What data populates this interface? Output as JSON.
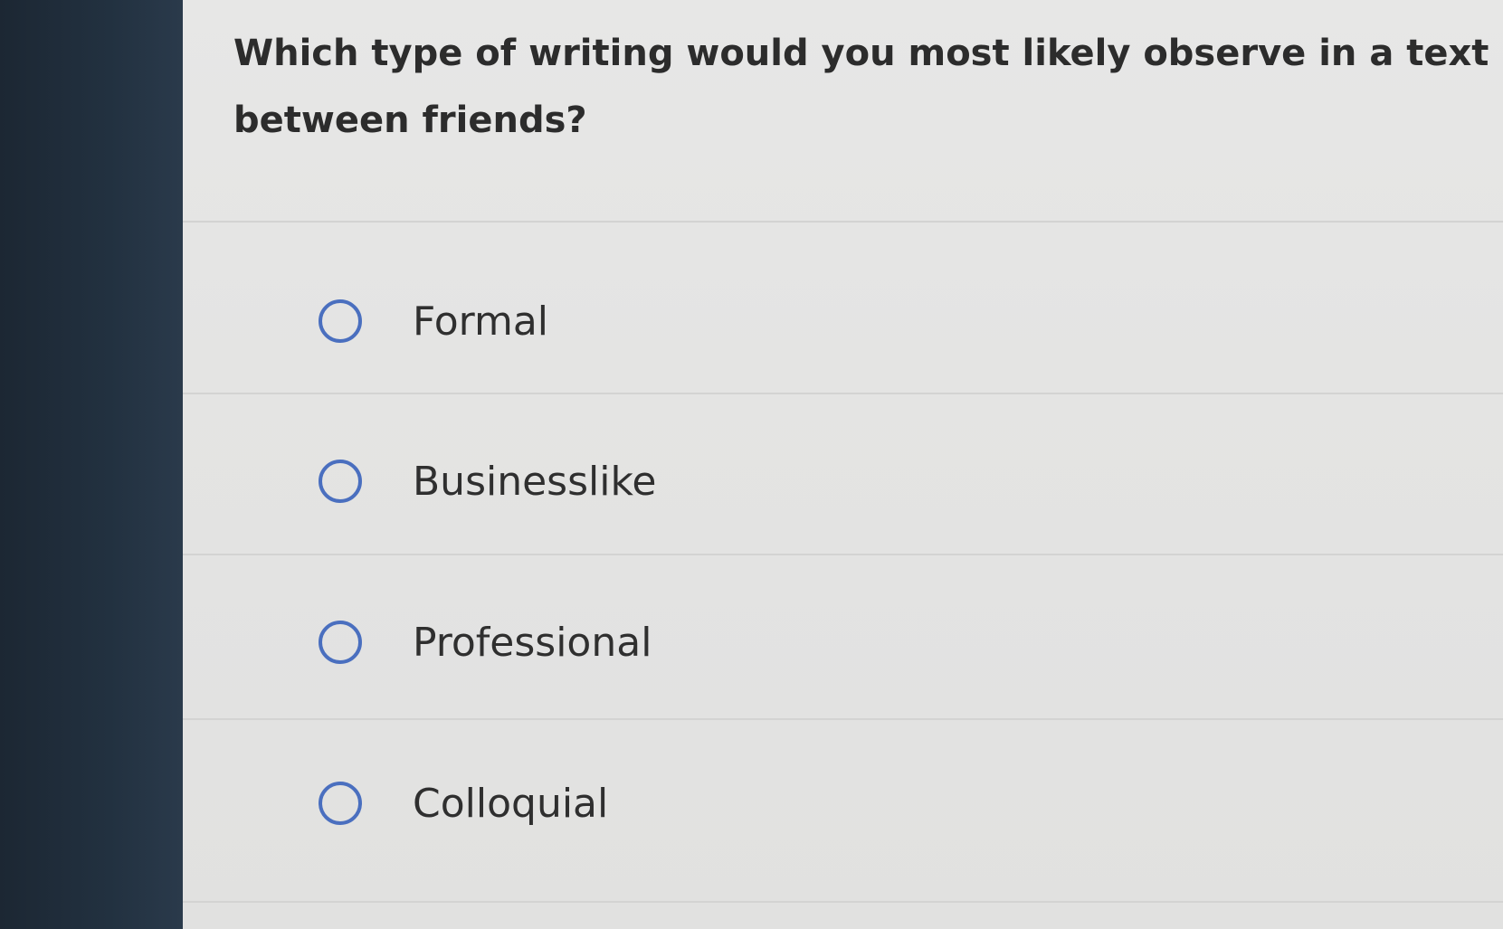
{
  "question": {
    "text_line1": "Which type of writing would you most likely observe in a text m",
    "text_line2": "between friends?"
  },
  "options": [
    {
      "label": "Formal",
      "selected": false
    },
    {
      "label": "Businesslike",
      "selected": false
    },
    {
      "label": "Professional",
      "selected": false
    },
    {
      "label": "Colloquial",
      "selected": false
    }
  ],
  "colors": {
    "radio_border": "#4a6fbf",
    "sidebar": "#1f2b38",
    "panel": "#e4e4e3"
  }
}
